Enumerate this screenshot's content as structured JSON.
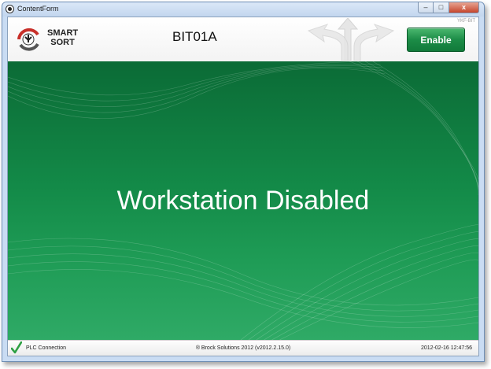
{
  "window": {
    "title": "ContentForm",
    "controls": {
      "minimize": "–",
      "maximize": "□",
      "close": "x"
    }
  },
  "header": {
    "logo": {
      "line1": "SMART",
      "line2": "SORT"
    },
    "station": "BIT01A",
    "code": "YKF-BIT",
    "enable_label": "Enable"
  },
  "main": {
    "message": "Workstation Disabled"
  },
  "footer": {
    "plc_label": "PLC Connection",
    "copyright": "® Brock Solutions 2012 (v2012.2.15.0)",
    "timestamp": "2012-02-16 12:47:56"
  },
  "colors": {
    "accent_green": "#1c8c47",
    "background_green": "#138a48",
    "logo_red": "#c8302a",
    "check_green": "#2ea043"
  },
  "icons": [
    "app-icon",
    "smart-sort-logo-icon",
    "direction-arrows-icon",
    "checkmark-icon"
  ]
}
